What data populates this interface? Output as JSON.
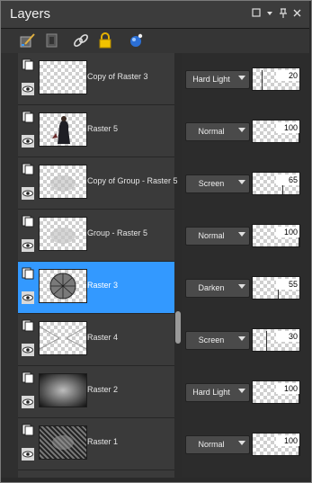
{
  "panel": {
    "title": "Layers"
  },
  "layers": [
    {
      "name": "Copy of Raster 3",
      "blend": "Hard Light",
      "opacity": 20,
      "selected": false
    },
    {
      "name": "Raster 5",
      "blend": "Normal",
      "opacity": 100,
      "selected": false
    },
    {
      "name": "Copy of Group - Raster 5",
      "blend": "Screen",
      "opacity": 65,
      "selected": false
    },
    {
      "name": "Group - Raster 5",
      "blend": "Normal",
      "opacity": 100,
      "selected": false
    },
    {
      "name": "Raster 3",
      "blend": "Darken",
      "opacity": 55,
      "selected": true
    },
    {
      "name": "Raster 4",
      "blend": "Screen",
      "opacity": 30,
      "selected": false
    },
    {
      "name": "Raster 2",
      "blend": "Hard Light",
      "opacity": 100,
      "selected": false
    },
    {
      "name": "Raster 1",
      "blend": "Normal",
      "opacity": 100,
      "selected": false
    }
  ],
  "colors": {
    "selection": "#3399ff",
    "panel_bg": "#3a3a3a"
  }
}
